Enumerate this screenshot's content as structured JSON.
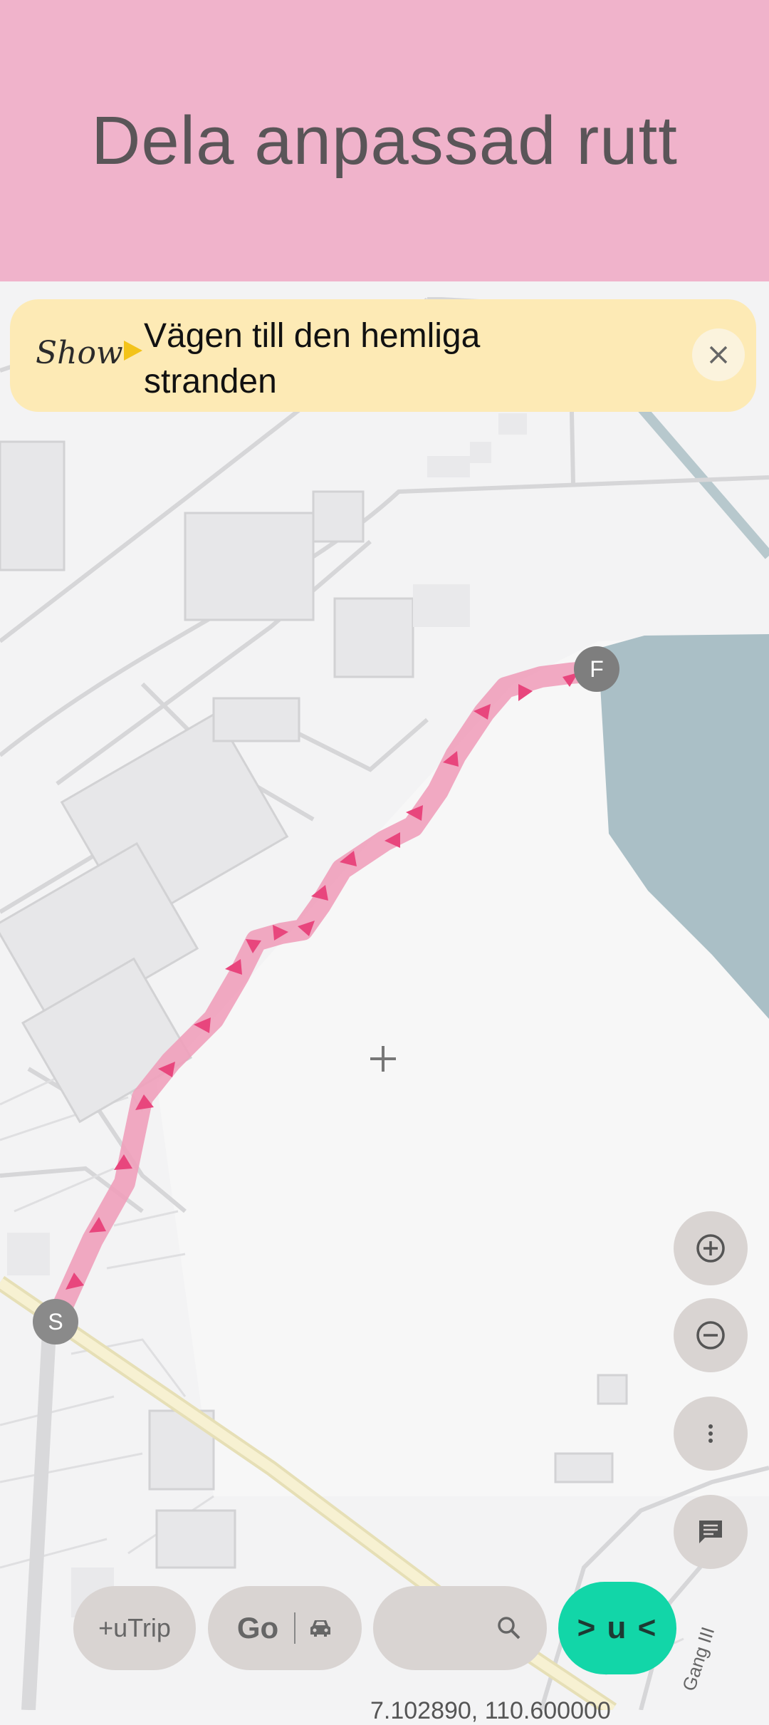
{
  "header": {
    "title": "Dela anpassad rutt"
  },
  "banner": {
    "logo_text": "Show",
    "route_name": "Vägen till den hemliga stranden"
  },
  "map": {
    "start_label": "S",
    "finish_label": "F",
    "street_label": "Gang III",
    "coordinates": "7.102890, 110.600000"
  },
  "controls": {
    "utrip_label": "+uTrip",
    "go_label": "Go",
    "search_placeholder": "",
    "active_button_label": "> u <"
  },
  "colors": {
    "header_bg": "#f0b3cb",
    "banner_bg": "#fdeab5",
    "route": "#e8467d",
    "water": "#aabfc6",
    "accent_button": "#12d6a8",
    "fab_bg": "#d9d4d2"
  },
  "icons": [
    "close-icon",
    "zoom-in-icon",
    "zoom-out-icon",
    "more-vert-icon",
    "chat-icon",
    "car-icon",
    "search-icon",
    "crosshair-icon"
  ]
}
